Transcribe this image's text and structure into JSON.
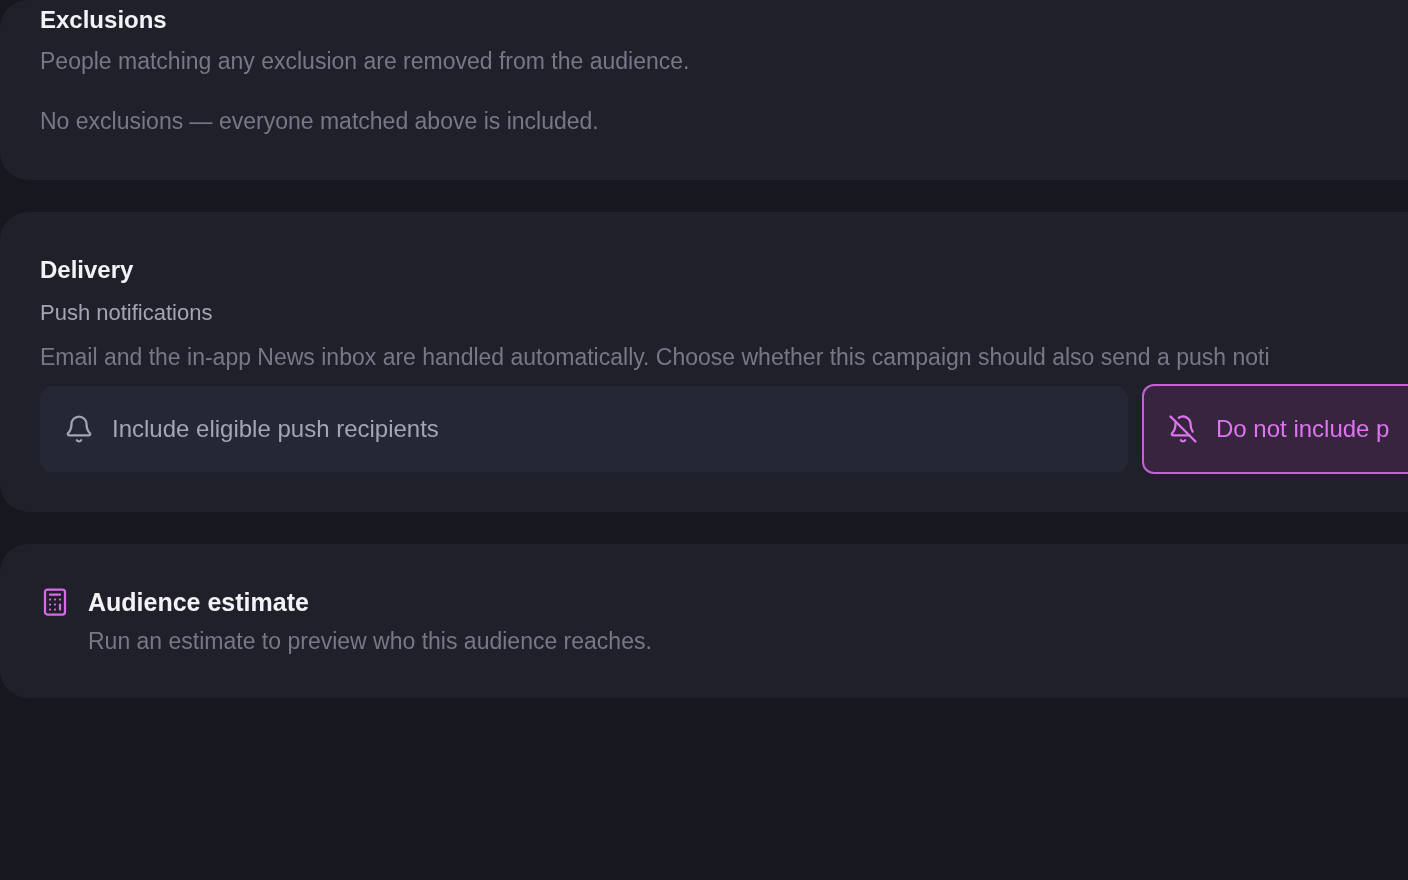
{
  "sections": [
    {
      "kind": "exclusions",
      "title": "Exclusions",
      "description": "People matching any exclusion are removed from the audience.",
      "empty_message": "No exclusions — everyone matched above is included."
    },
    {
      "kind": "delivery",
      "title": "Delivery",
      "subtitle": "Push notifications",
      "description": "Email and the in-app News inbox are handled automatically. Choose whether this campaign should also send a push noti",
      "options": [
        {
          "kind": "bell",
          "label": "Include eligible push recipients",
          "selected": false
        },
        {
          "kind": "bell-off",
          "label": "Do not include p",
          "selected": true
        }
      ]
    },
    {
      "kind": "estimate",
      "title": "Audience estimate",
      "description": "Run an estimate to preview who this audience reaches."
    }
  ]
}
